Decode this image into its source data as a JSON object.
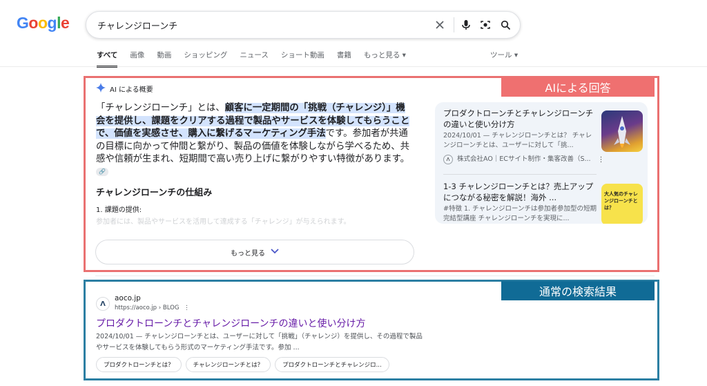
{
  "logo": {
    "letters": [
      "G",
      "o",
      "o",
      "g",
      "l",
      "e"
    ],
    "colors": [
      "#4285F4",
      "#EA4335",
      "#FBBC05",
      "#4285F4",
      "#34A853",
      "#EA4335"
    ]
  },
  "search": {
    "query": "チャレンジローンチ"
  },
  "tabs": [
    "すべて",
    "画像",
    "動画",
    "ショッピング",
    "ニュース",
    "ショート動画",
    "書籍",
    "もっと見る ▾"
  ],
  "tools_label": "ツール ▾",
  "ai": {
    "banner": "AIによる回答",
    "header": "AI による概要",
    "body_pre": "「チャレンジローンチ」とは、",
    "body_hl": "顧客に一定期間の「挑戦（チャレンジ）」機会を提供し、課題をクリアする過程で製品やサービスを体験してもらうことで、価値を実感させ、購入に繋げるマーケティング手法",
    "body_post": "です。参加者が共通の目標に向かって仲間と繋がり、製品の価値を体験しながら学べるため、共感や信頼が生まれ、短期間で高い売り上げに繋がりやすい特徴があります。",
    "subheading": "チャレンジローンチの仕組み",
    "item1": "1. 課題の提供:",
    "item1_fade": "参加者には、製品やサービスを活用して達成する「チャレンジ」が与えられます。",
    "more_label": "もっと見る",
    "cards": [
      {
        "title": "プロダクトローンチとチャレンジローンチの違いと使い分け方",
        "snippet": "2024/10/01 — チャレンジローンチとは？ チャレンジローンチとは、ユーザーに対して「挑...",
        "source": "株式会社AO｜ECサイト制作・集客改善（S..."
      },
      {
        "title": "1-3 チャレンジローンチとは？売上アップにつながる秘密を解説！海外 ...",
        "snippet": "#特徴 1. チャレンジローンチは参加者参加型の短期完結型講座 チャレンジローンチを実現に..."
      }
    ],
    "thumb2_text": "大人気のチャレンジローンチとは？"
  },
  "normal": {
    "banner": "通常の検索結果",
    "site_name": "aoco.jp",
    "site_url": "https://aoco.jp › BLOG",
    "title": "プロダクトローンチとチャレンジローンチの違いと使い分け方",
    "snippet": "2024/10/01 — チャレンジローンチとは、ユーザーに対して「挑戦」（チャレンジ）を提供し、その過程で製品やサービスを体験してもらう形式のマーケティング手法です。参加 ...",
    "chips": [
      "プロダクトローンチとは？",
      "チャレンジローンチとは？",
      "プロダクトローンチとチャレンジロ..."
    ]
  }
}
